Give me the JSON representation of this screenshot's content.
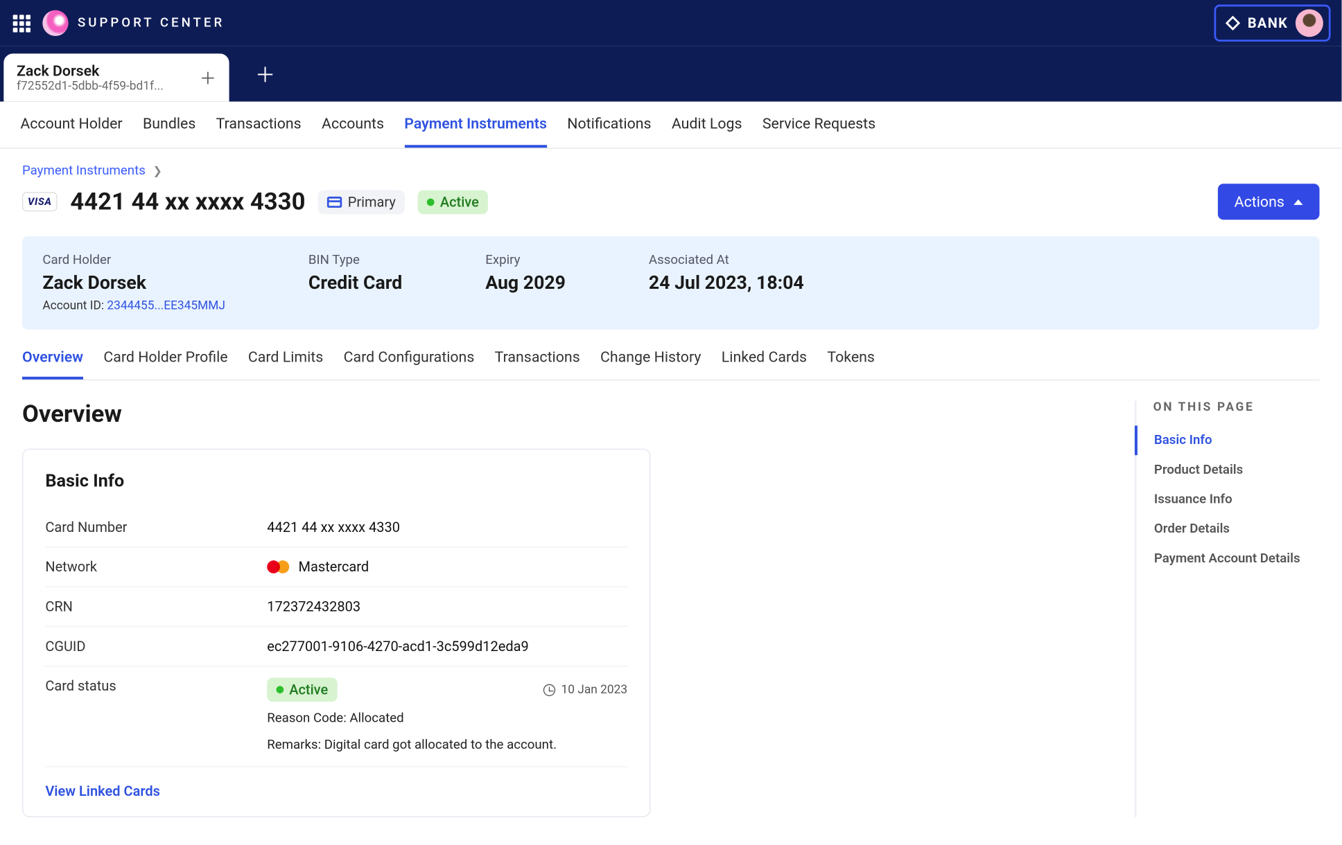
{
  "header": {
    "brand": "SUPPORT CENTER",
    "bank": "BANK"
  },
  "tabs": {
    "active": {
      "title": "Zack Dorsek",
      "subtitle": "f72552d1-5dbb-4f59-bd1f..."
    }
  },
  "mainNav": [
    "Account Holder",
    "Bundles",
    "Transactions",
    "Accounts",
    "Payment Instruments",
    "Notifications",
    "Audit Logs",
    "Service Requests"
  ],
  "mainNavActive": "Payment Instruments",
  "breadcrumb": {
    "root": "Payment Instruments"
  },
  "card": {
    "brand": "VISA",
    "number_masked": "4421 44 xx xxxx 4330",
    "primary": "Primary",
    "status": "Active",
    "actions": "Actions"
  },
  "summary": {
    "card_holder_label": "Card Holder",
    "card_holder_value": "Zack Dorsek",
    "account_id_label": "Account ID:",
    "account_id_value": "2344455...EE345MMJ",
    "bin_label": "BIN Type",
    "bin_value": "Credit Card",
    "expiry_label": "Expiry",
    "expiry_value": "Aug 2029",
    "assoc_label": "Associated At",
    "assoc_value": "24 Jul 2023, 18:04"
  },
  "subNav": [
    "Overview",
    "Card Holder Profile",
    "Card Limits",
    "Card Configurations",
    "Transactions",
    "Change History",
    "Linked Cards",
    "Tokens"
  ],
  "subNavActive": "Overview",
  "overview": {
    "heading": "Overview",
    "panel_title": "Basic Info",
    "rows": {
      "card_number_k": "Card Number",
      "card_number_v": "4421 44 xx xxxx 4330",
      "network_k": "Network",
      "network_v": "Mastercard",
      "crn_k": "CRN",
      "crn_v": "172372432803",
      "cguid_k": "CGUID",
      "cguid_v": "ec277001-9106-4270-acd1-3c599d12eda9",
      "status_k": "Card status",
      "status_v": "Active",
      "status_date": "10 Jan 2023",
      "reason": "Reason Code: Allocated",
      "remarks": "Remarks: Digital card got allocated to the account."
    },
    "link": "View Linked Cards"
  },
  "otp": {
    "heading": "ON THIS PAGE",
    "items": [
      "Basic Info",
      "Product Details",
      "Issuance Info",
      "Order Details",
      "Payment Account Details"
    ],
    "active": "Basic Info"
  }
}
